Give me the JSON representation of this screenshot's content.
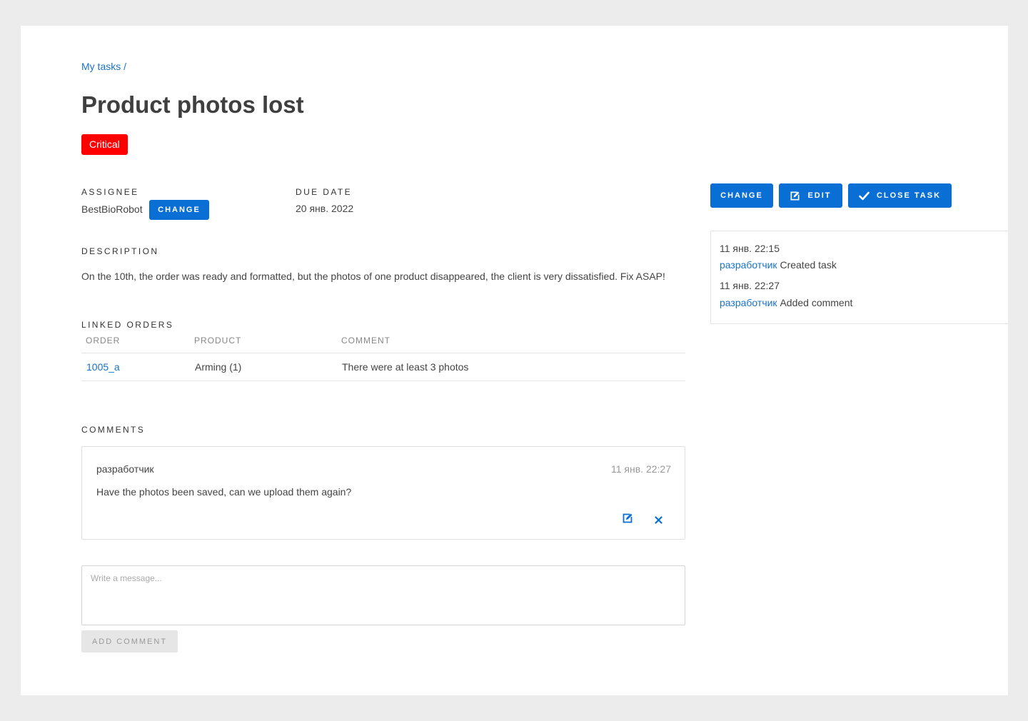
{
  "breadcrumb": "My tasks /",
  "title": "Product photos lost",
  "priority": {
    "label": "Critical",
    "color": "#ff0000"
  },
  "assignee": {
    "label": "ASSIGNEE",
    "name": "BestBioRobot",
    "change_label": "CHANGE"
  },
  "due_date": {
    "label": "DUE DATE",
    "value": "20 янв. 2022"
  },
  "description": {
    "label": "DESCRIPTION",
    "text": "On the 10th, the order was ready and formatted, but the photos of one product disappeared, the client is very dissatisfied. Fix ASAP!"
  },
  "linked_orders": {
    "label": "LINKED ORDERS",
    "columns": [
      "ORDER",
      "PRODUCT",
      "COMMENT"
    ],
    "rows": [
      {
        "order": "1005_a",
        "product": "Arming (1)",
        "comment": "There were at least 3 photos"
      }
    ]
  },
  "comments": {
    "label": "COMMENTS",
    "items": [
      {
        "author": "разработчик",
        "time": "11 янв. 22:27",
        "text": "Have the photos been saved, can we upload them again?",
        "edit_icon": "edit-icon",
        "delete_icon": "close-icon"
      }
    ],
    "input_placeholder": "Write a message...",
    "add_label": "ADD COMMENT"
  },
  "actions": {
    "change_label": "CHANGE",
    "edit_label": "EDIT",
    "close_label": "CLOSE TASK",
    "accent": "#0a6fd4"
  },
  "history": [
    {
      "time": "11 янв. 22:15",
      "user": "разработчик",
      "action": "Created task"
    },
    {
      "time": "11 янв. 22:27",
      "user": "разработчик",
      "action": "Added comment"
    }
  ]
}
